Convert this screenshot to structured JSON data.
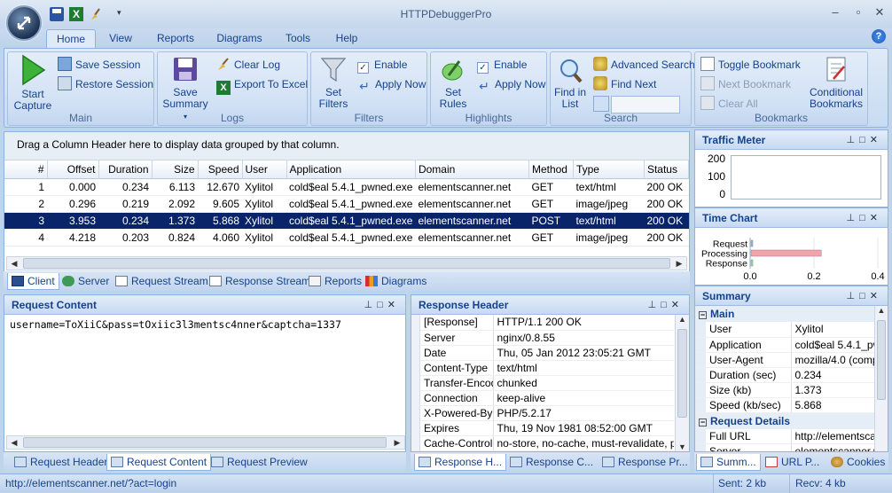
{
  "app": {
    "title": "HTTPDebuggerPro"
  },
  "tabs": [
    "Home",
    "View",
    "Reports",
    "Diagrams",
    "Tools",
    "Help"
  ],
  "ribbon": {
    "main": {
      "title": "Main",
      "start": [
        "Start",
        "Capture"
      ],
      "save_session": "Save Session",
      "restore_session": "Restore Session"
    },
    "logs": {
      "title": "Logs",
      "save_summary": [
        "Save",
        "Summary"
      ],
      "clear_log": "Clear Log",
      "export_excel": "Export To Excel"
    },
    "filters": {
      "title": "Filters",
      "set_filters": [
        "Set",
        "Filters"
      ],
      "enable": "Enable",
      "apply_now": "Apply Now"
    },
    "highlights": {
      "title": "Highlights",
      "set_rules": [
        "Set",
        "Rules"
      ],
      "enable": "Enable",
      "apply_now": "Apply Now"
    },
    "search": {
      "title": "Search",
      "find_in_list": [
        "Find in",
        "List"
      ],
      "advanced_search": "Advanced Search",
      "find_next": "Find Next",
      "search_value": ""
    },
    "bookmarks": {
      "title": "Bookmarks",
      "toggle": "Toggle Bookmark",
      "next": "Next Bookmark",
      "clear_all": "Clear All",
      "conditional": [
        "Conditional",
        "Bookmarks"
      ]
    }
  },
  "grid": {
    "group_hint": "Drag a Column Header here to display data grouped by that column.",
    "columns": [
      "#",
      "Offset",
      "Duration",
      "Size",
      "Speed",
      "User",
      "Application",
      "Domain",
      "Method",
      "Type",
      "Status"
    ],
    "rows": [
      [
        "1",
        "0.000",
        "0.234",
        "6.113",
        "12.670",
        "Xylitol",
        "cold$eal 5.4.1_pwned.exe",
        "elementscanner.net",
        "GET",
        "text/html",
        "200 OK"
      ],
      [
        "2",
        "0.296",
        "0.219",
        "2.092",
        "9.605",
        "Xylitol",
        "cold$eal 5.4.1_pwned.exe",
        "elementscanner.net",
        "GET",
        "image/jpeg",
        "200 OK"
      ],
      [
        "3",
        "3.953",
        "0.234",
        "1.373",
        "5.868",
        "Xylitol",
        "cold$eal 5.4.1_pwned.exe",
        "elementscanner.net",
        "POST",
        "text/html",
        "200 OK"
      ],
      [
        "4",
        "4.218",
        "0.203",
        "0.824",
        "4.060",
        "Xylitol",
        "cold$eal 5.4.1_pwned.exe",
        "elementscanner.net",
        "GET",
        "image/jpeg",
        "200 OK"
      ]
    ],
    "selected_row": 2
  },
  "view_tabs": [
    "Client",
    "Server",
    "Request Stream",
    "Response Stream",
    "Reports",
    "Diagrams"
  ],
  "request_content": {
    "title": "Request Content",
    "body": "username=ToXiiC&pass=tOxiic3l3mentsc4nner&captcha=1337"
  },
  "request_tabs": [
    "Request Header",
    "Request Content",
    "Request Preview"
  ],
  "response_header": {
    "title": "Response Header",
    "rows": [
      [
        "[Response]",
        "HTTP/1.1 200 OK"
      ],
      [
        "Server",
        "nginx/0.8.55"
      ],
      [
        "Date",
        "Thu, 05 Jan 2012 23:05:21 GMT"
      ],
      [
        "Content-Type",
        "text/html"
      ],
      [
        "Transfer-Encodi",
        "chunked"
      ],
      [
        "Connection",
        "keep-alive"
      ],
      [
        "X-Powered-By",
        "PHP/5.2.17"
      ],
      [
        "Expires",
        "Thu, 19 Nov 1981 08:52:00 GMT"
      ],
      [
        "Cache-Control",
        "no-store, no-cache, must-revalidate, post"
      ]
    ]
  },
  "response_tabs": [
    "Response H...",
    "Response C...",
    "Response Pr..."
  ],
  "traffic_meter": {
    "title": "Traffic Meter",
    "ticks": [
      "200",
      "100",
      "0"
    ]
  },
  "time_chart": {
    "title": "Time Chart"
  },
  "chart_data": {
    "type": "bar",
    "categories": [
      "Request",
      "Processing",
      "Response"
    ],
    "values": [
      0.005,
      0.22,
      0.004
    ],
    "xlim": [
      0,
      0.4
    ],
    "xticks": [
      "0.0",
      "0.2",
      "0.4"
    ],
    "colors": [
      "#9db6e0",
      "#f4a3a8",
      "#8fe38f"
    ]
  },
  "summary": {
    "title": "Summary",
    "main_title": "Main",
    "main_rows": [
      [
        "User",
        "Xylitol"
      ],
      [
        "Application",
        "cold$eal 5.4.1_pw"
      ],
      [
        "User-Agent",
        "mozilla/4.0 (compa"
      ],
      [
        "Duration (sec)",
        "0.234"
      ],
      [
        "Size (kb)",
        "1.373"
      ],
      [
        "Speed (kb/sec)",
        "5.868"
      ]
    ],
    "details_title": "Request Details",
    "details_rows": [
      [
        "Full URL",
        "http://elementscan"
      ],
      [
        "Server",
        "elementscanner.n"
      ]
    ]
  },
  "side_tabs": [
    "Summ...",
    "URL P...",
    "Cookies"
  ],
  "status": {
    "url": "http://elementscanner.net/?act=login",
    "sent": "Sent: 2 kb",
    "recv": "Recv: 4 kb"
  }
}
